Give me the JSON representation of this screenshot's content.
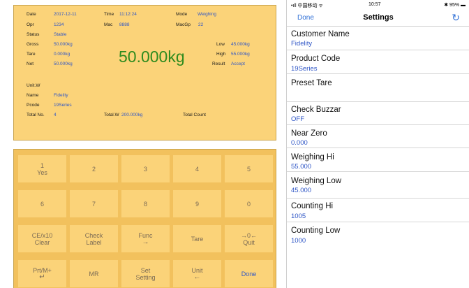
{
  "display": {
    "date_label": "Date",
    "date_value": "2017-12-11",
    "time_label": "Time",
    "time_value": "11:12:24",
    "mode_label": "Mode",
    "mode_value": "Weighing",
    "opr_label": "Opr",
    "opr_value": "1234",
    "mac_label": "Mac",
    "mac_value": "8888",
    "macgp_label": "MacGp",
    "macgp_value": "22",
    "status_label": "Status",
    "status_value": "Stable",
    "gross_label": "Gross",
    "gross_value": "50.000kg",
    "tare_label": "Tare",
    "tare_value": "0.000kg",
    "net_label": "Net",
    "net_value": "50.000kg",
    "main_weight": "50.000kg",
    "low_label": "Low",
    "low_value": "45.000kg",
    "high_label": "High",
    "high_value": "55.000kg",
    "result_label": "Result",
    "result_value": "Accept",
    "unitw_label": "Unit.W",
    "name_label": "Name",
    "name_value": "Fidelity",
    "pcode_label": "Pcode",
    "pcode_value": "19Series",
    "totalno_label": "Total No.",
    "totalno_value": "4",
    "totalw_label": "Total.W",
    "totalw_value": "200.000kg",
    "totalcount_label": "Total Count"
  },
  "keypad": {
    "k1_line1": "1",
    "k1_line2": "Yes",
    "k2": "2",
    "k3": "3",
    "k4": "4",
    "k5": "5",
    "k6": "6",
    "k7": "7",
    "k8": "8",
    "k9": "9",
    "k0": "0",
    "clear_line1": "CE/x10",
    "clear_line2": "Clear",
    "check_line1": "Check",
    "check_line2": "Label",
    "func_line1": "Func",
    "func_line2": "→",
    "tare": "Tare",
    "quit_line1": "→0←",
    "quit_line2": "Quit",
    "prt_line1": "Prt/M+",
    "prt_line2": "↵",
    "mr": "MR",
    "set_line1": "Set",
    "set_line2": "Setting",
    "unit_line1": "Unit",
    "unit_line2": "←",
    "done": "Done"
  },
  "phone": {
    "carrier": "•ıll 中国移动 ᯤ",
    "time": "10:57",
    "battery": "✱ 95% ▬",
    "nav_done": "Done",
    "nav_title": "Settings",
    "refresh_icon": "↻",
    "settings": [
      {
        "label": "Customer Name",
        "value": "Fidelity"
      },
      {
        "label": "Product Code",
        "value": "19Series"
      },
      {
        "label": "Preset Tare",
        "value": ""
      },
      {
        "label": "Check Buzzar",
        "value": "OFF"
      },
      {
        "label": "Near Zero",
        "value": "0.000"
      },
      {
        "label": "Weighing Hi",
        "value": "55.000"
      },
      {
        "label": "Weighing Low",
        "value": "45.000"
      },
      {
        "label": "Counting Hi",
        "value": "1005"
      },
      {
        "label": "Counting Low",
        "value": "1000"
      }
    ]
  }
}
